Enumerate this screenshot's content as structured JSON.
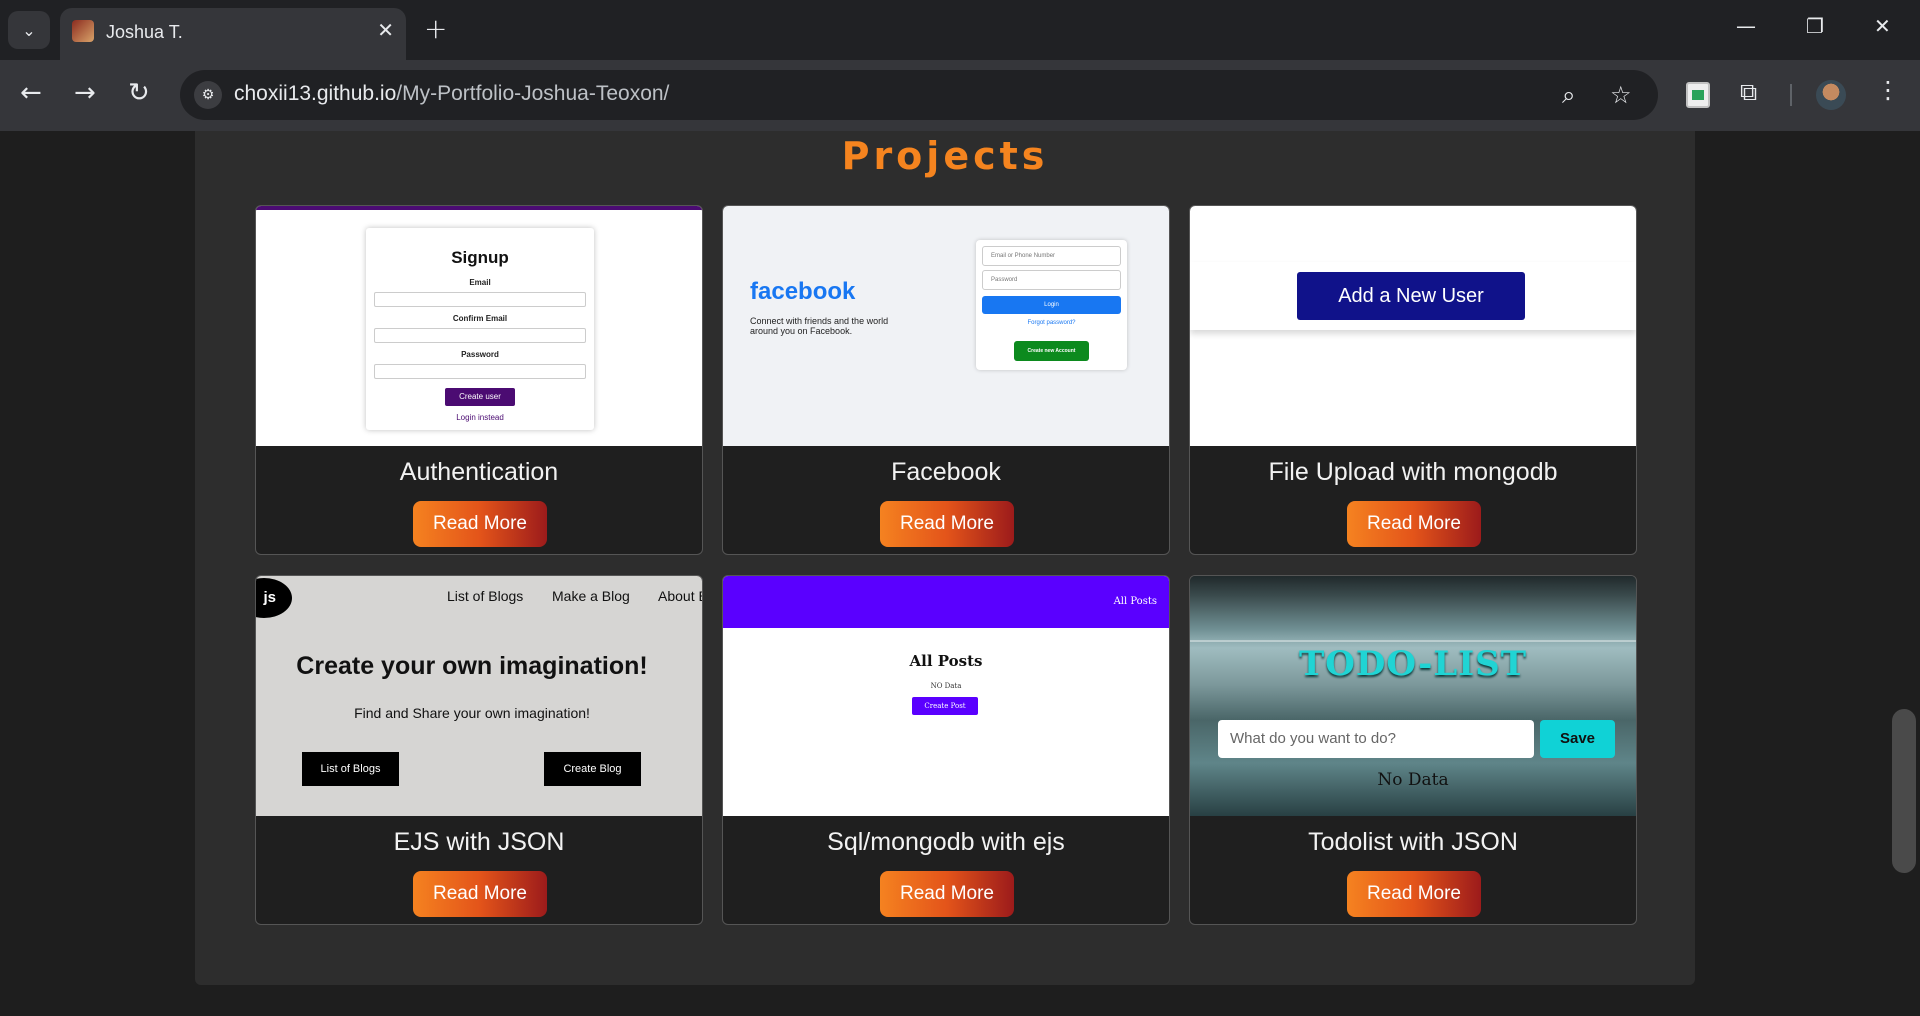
{
  "browser": {
    "tab_title": "Joshua T.",
    "url_host": "choxii13.github.io",
    "url_path": "/My-Portfolio-Joshua-Teoxon/"
  },
  "section": {
    "heading": "Projects"
  },
  "projects": [
    {
      "title": "Authentication",
      "button": "Read More",
      "preview": {
        "heading": "Signup",
        "labels": [
          "Email",
          "Confirm Email",
          "Password"
        ],
        "button": "Create user",
        "link": "Login instead"
      }
    },
    {
      "title": "Facebook",
      "button": "Read More",
      "preview": {
        "logo": "facebook",
        "tagline": "Connect with friends and the world around you on Facebook.",
        "email_placeholder": "Email or Phone Number",
        "password_placeholder": "Password",
        "login": "Login",
        "forgot": "Forgot password?",
        "create": "Create new Account"
      }
    },
    {
      "title": "File Upload with mongodb",
      "button": "Read More",
      "preview": {
        "button": "Add a New User"
      }
    },
    {
      "title": "EJS with JSON",
      "button": "Read More",
      "preview": {
        "logo": "js",
        "nav": [
          "List of Blogs",
          "Make a Blog",
          "About B"
        ],
        "heading": "Create your own imagination!",
        "subheading": "Find and Share your own imagination!",
        "left_button": "List of Blogs",
        "right_button": "Create Blog"
      }
    },
    {
      "title": "Sql/mongodb with ejs",
      "button": "Read More",
      "preview": {
        "nav": "All Posts",
        "heading": "All Posts",
        "empty": "NO Data",
        "button": "Create Post"
      }
    },
    {
      "title": "Todolist with JSON",
      "button": "Read More",
      "preview": {
        "heading": "TODO-LIST",
        "input_placeholder": "What do you want to do?",
        "button": "Save",
        "empty": "No Data"
      }
    }
  ],
  "colors": {
    "heading": "#f5841f",
    "button_start": "#f58220",
    "button_end": "#9c1b1b",
    "panel": "#2d2d2d"
  }
}
